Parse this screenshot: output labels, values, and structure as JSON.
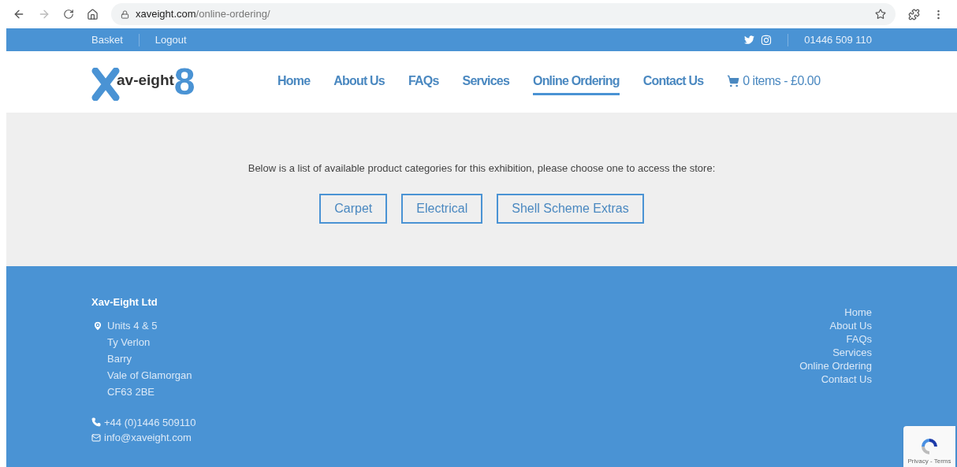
{
  "browser": {
    "url_host": "xaveight.com",
    "url_path": "/online-ordering/"
  },
  "topbar": {
    "links": [
      "Basket",
      "Logout"
    ],
    "phone": "01446 509 110"
  },
  "logo": {
    "text": "av-eight",
    "digit": "8"
  },
  "nav": [
    {
      "label": "Home",
      "selected": false
    },
    {
      "label": "About Us",
      "selected": false
    },
    {
      "label": "FAQs",
      "selected": false
    },
    {
      "label": "Services",
      "selected": false
    },
    {
      "label": "Online Ordering",
      "selected": true
    },
    {
      "label": "Contact Us",
      "selected": false
    }
  ],
  "cart": "0 items - £0.00",
  "intro": "Below is a list of available product categories for this exhibition, please choose one to access the store:",
  "categories": [
    "Carpet",
    "Electrical",
    "Shell Scheme Extras"
  ],
  "footer": {
    "company": "Xav-Eight Ltd",
    "address": [
      "Units 4 & 5",
      "Ty Verlon",
      "Barry",
      "Vale of Glamorgan",
      "CF63 2BE"
    ],
    "phone": "+44 (0)1446 509110",
    "email": "info@xaveight.com",
    "links": [
      "Home",
      "About Us",
      "FAQs",
      "Services",
      "Online Ordering",
      "Contact Us"
    ]
  },
  "recaptcha": "Privacy - Terms"
}
